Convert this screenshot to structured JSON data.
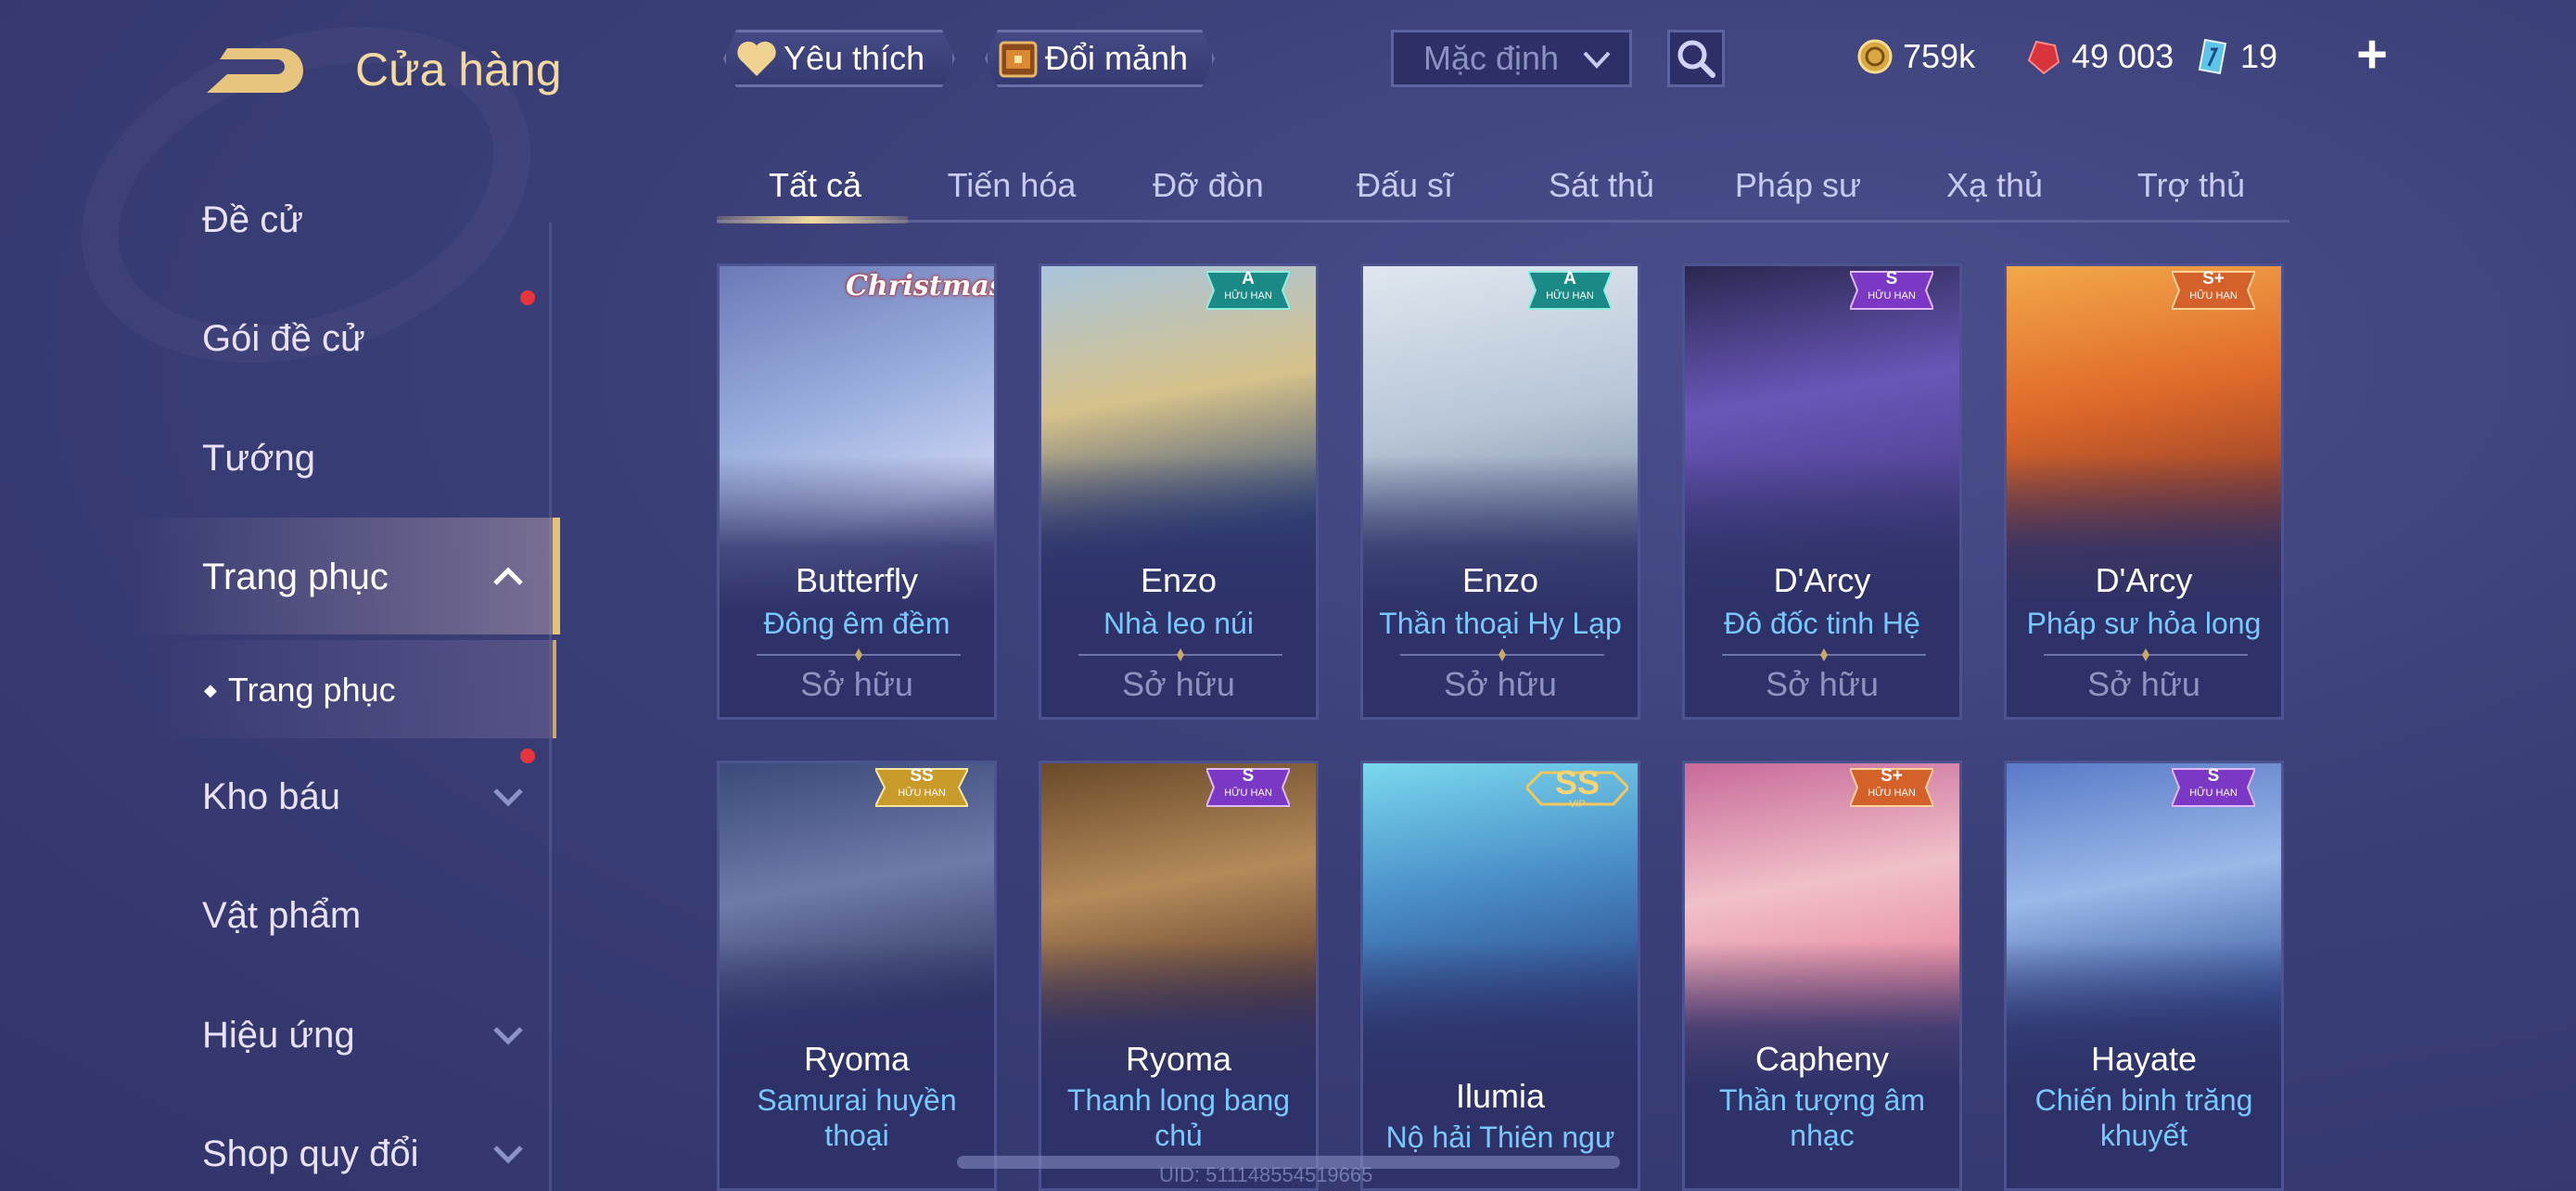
{
  "header": {
    "title": "Cửa hàng",
    "favorites_label": "Yêu thích",
    "trade_label": "Đổi mảnh",
    "sort_selected": "Mặc định",
    "currencies": {
      "gold": "759k",
      "gems": "49 003",
      "vouchers": "19"
    },
    "plus_label": "+"
  },
  "sidebar": {
    "items": [
      {
        "label": "Đề cử"
      },
      {
        "label": "Gói đề cử"
      },
      {
        "label": "Tướng"
      },
      {
        "label": "Trang phục"
      },
      {
        "label": "Kho báu"
      },
      {
        "label": "Vật phẩm"
      },
      {
        "label": "Hiệu ứng"
      },
      {
        "label": "Shop quy đổi"
      }
    ],
    "sub_item": "Trang phục",
    "sub_bullet": "◆"
  },
  "tabs": [
    "Tất cả",
    "Tiến hóa",
    "Đỡ đòn",
    "Đấu sĩ",
    "Sát thủ",
    "Pháp sư",
    "Xạ thủ",
    "Trợ thủ"
  ],
  "cards_row1": [
    {
      "hero": "Butterfly",
      "skin": "Đông êm đềm",
      "status": "Sở hữu",
      "tag": "Christmas"
    },
    {
      "hero": "Enzo",
      "skin": "Nhà leo núi",
      "status": "Sở hữu",
      "tier": "A",
      "limited": "HỮU HẠN"
    },
    {
      "hero": "Enzo",
      "skin": "Thần thoại Hy Lạp",
      "status": "Sở hữu",
      "tier": "A",
      "limited": "HỮU HẠN"
    },
    {
      "hero": "D'Arcy",
      "skin": "Đô đốc tinh Hệ",
      "status": "Sở hữu",
      "tier": "S",
      "limited": "HỮU HẠN"
    },
    {
      "hero": "D'Arcy",
      "skin": "Pháp sư hỏa long",
      "status": "Sở hữu",
      "tier": "S+",
      "limited": "HỮU HẠN"
    }
  ],
  "cards_row2": [
    {
      "hero": "Ryoma",
      "skin_line1": "Samurai huyền",
      "skin_line2": "thoại",
      "tier": "SS",
      "limited": "HỮU HẠN"
    },
    {
      "hero": "Ryoma",
      "skin_line1": "Thanh long bang",
      "skin_line2": "chủ",
      "tier": "S",
      "limited": "HỮU HẠN"
    },
    {
      "hero": "Ilumia",
      "skin_line1": "Nộ hải Thiên ngư",
      "tier": "SS",
      "limited": "VIP"
    },
    {
      "hero": "Capheny",
      "skin_line1": "Thần tượng âm",
      "skin_line2": "nhạc",
      "tier": "S+",
      "limited": "HỮU HẠN"
    },
    {
      "hero": "Hayate",
      "skin_line1": "Chiến binh trăng",
      "skin_line2": "khuyết",
      "tier": "S",
      "limited": "HỮU HẠN"
    }
  ],
  "footer": {
    "uid": "UID: 511148554519665"
  },
  "colors": {
    "accent_gold": "#f3d9a0",
    "skin_name_blue": "#79c8ff",
    "badge_green": "#1b8a86",
    "badge_purple": "#7a38c4",
    "badge_orange": "#d4612a",
    "badge_gold": "#c79a2a",
    "notification_red": "#e8353c"
  }
}
